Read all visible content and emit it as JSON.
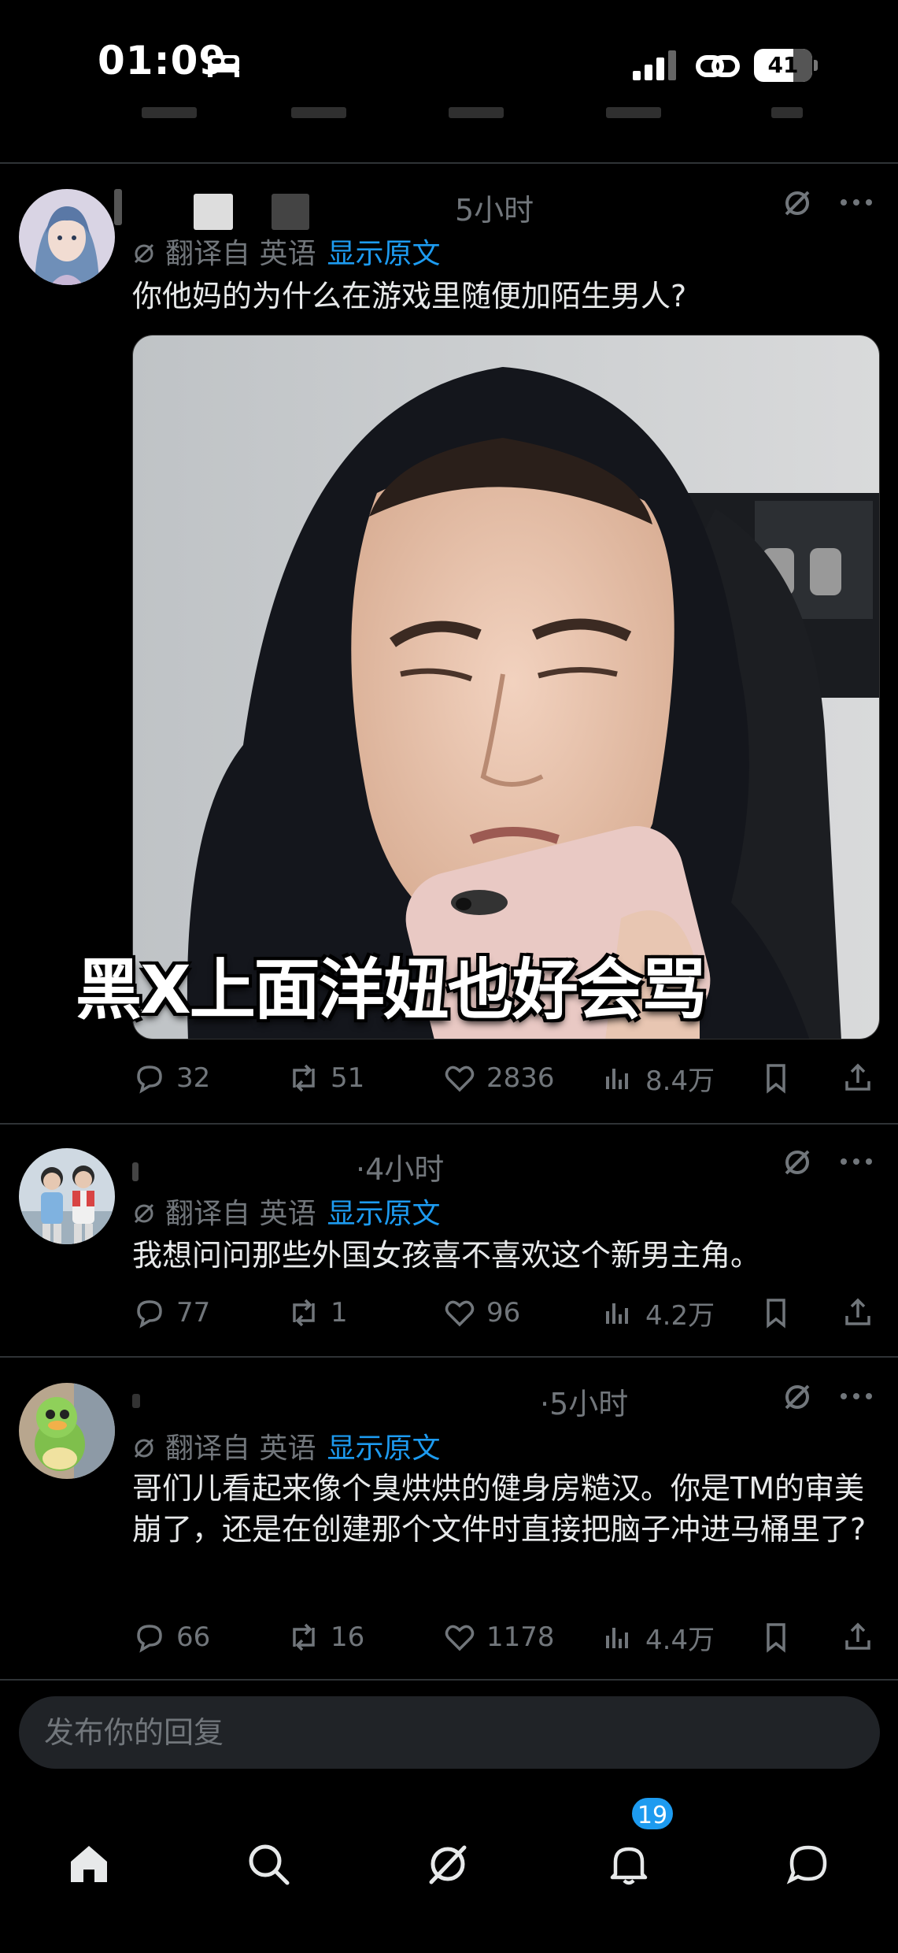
{
  "status_bar": {
    "time": "01:09",
    "battery": "41"
  },
  "tweets": [
    {
      "time": "5小时",
      "translation": {
        "label": "翻译自 英语",
        "show_original": "显示原文"
      },
      "text": "你他妈的为什么在游戏里随便加陌生男人?",
      "image_caption": "黑X上面洋妞也好会骂",
      "stats": {
        "replies": "32",
        "reposts": "51",
        "likes": "2836",
        "views": "8.4万"
      }
    },
    {
      "time": "·4小时",
      "translation": {
        "label": "翻译自 英语",
        "show_original": "显示原文"
      },
      "text": "我想问问那些外国女孩喜不喜欢这个新男主角。",
      "stats": {
        "replies": "77",
        "reposts": "1",
        "likes": "96",
        "views": "4.2万"
      }
    },
    {
      "time": "·5小时",
      "translation": {
        "label": "翻译自 英语",
        "show_original": "显示原文"
      },
      "text": "哥们儿看起来像个臭烘烘的健身房糙汉。你是TM的审美崩了，还是在创建那个文件时直接把脑子冲进马桶里了?",
      "stats": {
        "replies": "66",
        "reposts": "16",
        "likes": "1178",
        "views": "4.4万"
      }
    }
  ],
  "reply_box": {
    "placeholder": "发布你的回复"
  },
  "tab_bar": {
    "notifications_badge": "19"
  },
  "icons": [
    "home-icon",
    "search-icon",
    "grok-icon",
    "bell-icon",
    "messages-icon",
    "reply-icon",
    "repost-icon",
    "like-icon",
    "views-icon",
    "bookmark-icon",
    "share-icon",
    "more-icon"
  ]
}
